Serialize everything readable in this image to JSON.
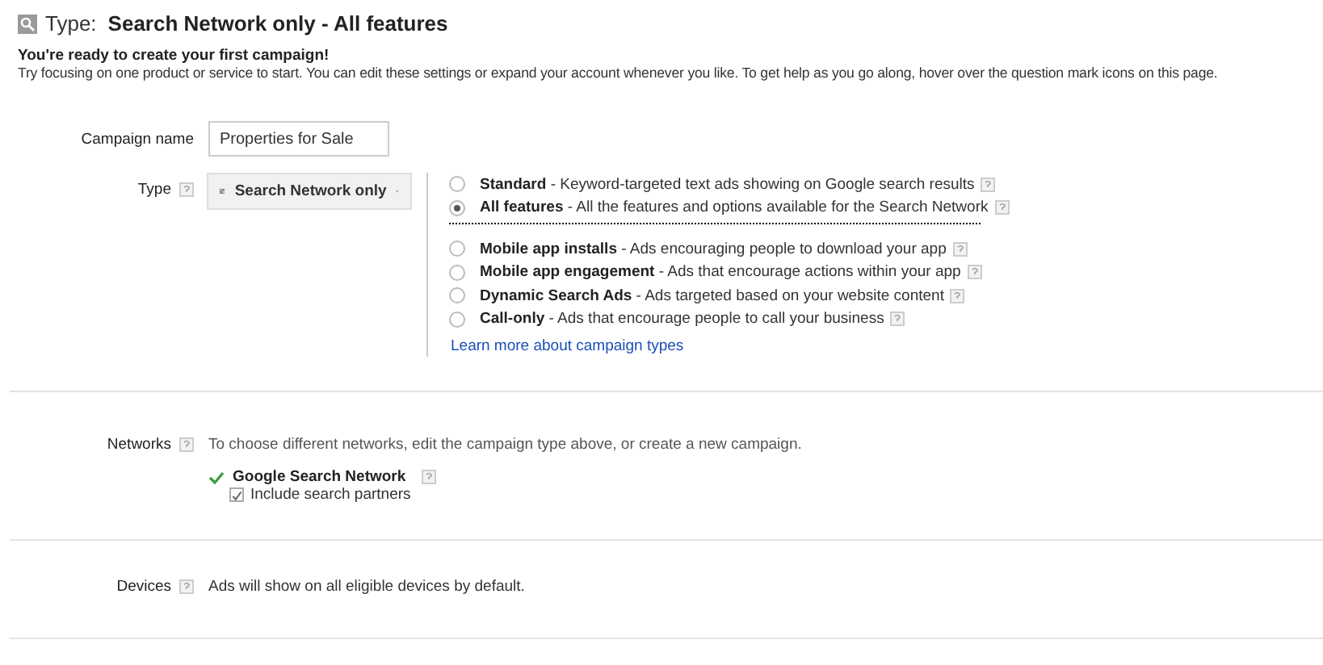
{
  "header": {
    "label": "Type:",
    "value": "Search Network only - All features"
  },
  "intro": {
    "title": "You're ready to create your first campaign!",
    "text": "Try focusing on one product or service to start. You can edit these settings or expand your account whenever you like. To get help as you go along, hover over the question mark icons on this page."
  },
  "campaign_name": {
    "label": "Campaign name",
    "value": "Properties for Sale"
  },
  "type": {
    "label": "Type",
    "dropdown": "Search Network only",
    "groups": [
      {
        "options": [
          {
            "name": "Standard",
            "description": " - Keyword-targeted text ads showing on Google search results",
            "selected": false
          },
          {
            "name": "All features",
            "description": " - All the features and options available for the Search Network",
            "selected": true
          }
        ]
      },
      {
        "options": [
          {
            "name": "Mobile app installs",
            "description": " - Ads encouraging people to download your app",
            "selected": false
          },
          {
            "name": "Mobile app engagement",
            "description": " - Ads that encourage actions within your app",
            "selected": false
          },
          {
            "name": "Dynamic Search Ads",
            "description": " - Ads targeted based on your website content",
            "selected": false
          },
          {
            "name": "Call-only",
            "description": " - Ads that encourage people to call your business",
            "selected": false
          }
        ]
      }
    ],
    "link": "Learn more about campaign types"
  },
  "networks": {
    "label": "Networks",
    "text": "To choose different networks, edit the campaign type above, or create a new campaign.",
    "network": "Google Search Network",
    "partners": {
      "label": "Include search partners",
      "checked": true
    }
  },
  "devices": {
    "label": "Devices",
    "text": "Ads will show on all eligible devices by default."
  }
}
